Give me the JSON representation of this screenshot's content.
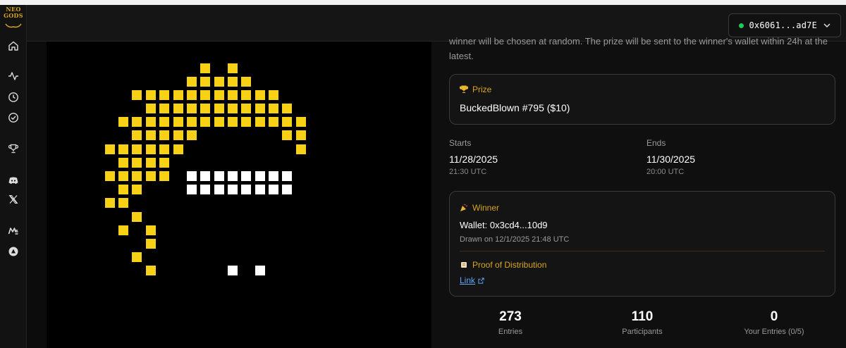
{
  "brand": {
    "logo_line1": "NEO",
    "logo_line2": "GODS"
  },
  "wallet": {
    "address": "0x6061...ad7E"
  },
  "sidebar": {
    "icons": [
      "home-icon",
      "activity-icon",
      "clock-icon",
      "check-circle-icon",
      "trophy-icon",
      "discord-icon",
      "x-icon",
      "magic-eden-icon",
      "tensor-icon"
    ]
  },
  "raffle": {
    "description": "winner will be chosen at random. The prize will be sent to the winner's wallet within 24h at the latest.",
    "prize": {
      "label": "Prize",
      "name": "BuckedBlown #795 ($10)"
    },
    "starts": {
      "label": "Starts",
      "date": "11/28/2025",
      "time": "21:30 UTC"
    },
    "ends": {
      "label": "Ends",
      "date": "11/30/2025",
      "time": "20:00 UTC"
    },
    "winner": {
      "label": "Winner",
      "wallet": "Wallet: 0x3cd4...10d9",
      "drawn": "Drawn on 12/1/2025 21:48 UTC",
      "proof_label": "Proof of Distribution",
      "link_label": "Link"
    },
    "stats": [
      {
        "value": "273",
        "label": "Entries"
      },
      {
        "value": "110",
        "label": "Participants"
      },
      {
        "value": "0",
        "label": "Your Entries (0/5)"
      }
    ]
  },
  "colors": {
    "accent": "#d9a520",
    "pixel_yellow": "#f7d116",
    "pixel_white": "#ffffff",
    "link": "#60a5fa",
    "online": "#22c55e"
  }
}
